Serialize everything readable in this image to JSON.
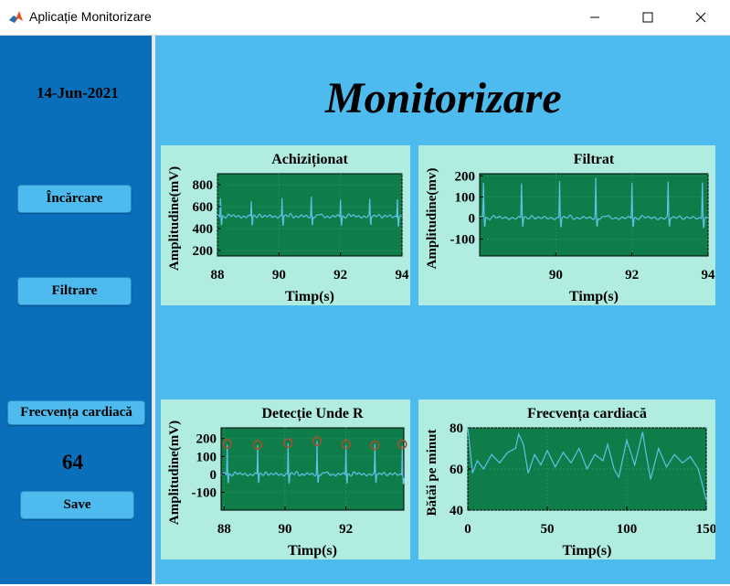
{
  "window": {
    "title": "Aplicație Monitorizare",
    "controls": [
      "minimize-icon",
      "maximize-icon",
      "close-icon"
    ]
  },
  "sidebar": {
    "date": "14-Jun-2021",
    "load_button": "Încărcare",
    "filter_button": "Filtrare",
    "heart_rate_button": "Frecvența cardiacă",
    "heart_rate_value": "64",
    "save_button": "Save"
  },
  "main": {
    "title": "Monitorizare"
  },
  "colors": {
    "sidebar": "#0a6fbb",
    "main": "#4dbbee",
    "panel": "#b0ece0",
    "plot_bg": "#0f7d4a",
    "signal": "#5fc3e8",
    "marker": "#a0522d"
  },
  "chart_data": [
    {
      "type": "line",
      "title": "Achiziționat",
      "xlabel": "Timp(s)",
      "ylabel": "Amplitudine(mV)",
      "xlim": [
        88,
        94
      ],
      "ylim": [
        150,
        900
      ],
      "xticks": [
        "88",
        "90",
        "92",
        "94"
      ],
      "yticks": [
        "200",
        "400",
        "600",
        "800"
      ],
      "baseline": 510,
      "peaks": [
        88.1,
        89.1,
        90.1,
        91.05,
        92.0,
        92.95,
        93.85
      ],
      "peak_values": [
        680,
        650,
        680,
        690,
        670,
        660,
        680
      ],
      "grid": true
    },
    {
      "type": "line",
      "title": "Filtrat",
      "xlabel": "Timp(s)",
      "ylabel": "Amplitudine(mv)",
      "xlim": [
        88,
        94
      ],
      "ylim": [
        -180,
        210
      ],
      "xticks": [
        "90",
        "92",
        "94"
      ],
      "yticks": [
        "-100",
        "0",
        "100",
        "200"
      ],
      "baseline": 0,
      "peaks": [
        88.1,
        89.1,
        90.1,
        91.05,
        92.0,
        92.95,
        93.85
      ],
      "peak_values": [
        170,
        165,
        175,
        190,
        170,
        165,
        175
      ],
      "grid": true
    },
    {
      "type": "line",
      "title": "Detecție Unde R",
      "xlabel": "Timp(s)",
      "ylabel": "Amplitudine(mV)",
      "xlim": [
        87.9,
        93.9
      ],
      "ylim": [
        -200,
        260
      ],
      "xticks": [
        "88",
        "90",
        "92"
      ],
      "yticks": [
        "-100",
        "0",
        "100",
        "200"
      ],
      "baseline": 0,
      "peaks": [
        88.1,
        89.1,
        90.1,
        91.05,
        92.0,
        92.95,
        93.85
      ],
      "peak_values": [
        170,
        165,
        175,
        185,
        168,
        162,
        168
      ],
      "markers": "R-peaks",
      "grid": true
    },
    {
      "type": "line",
      "title": "Frecvența cardiacă",
      "xlabel": "Timp(s)",
      "ylabel": "Bătăi pe minut",
      "xlim": [
        0,
        150
      ],
      "ylim": [
        40,
        80
      ],
      "xticks": [
        "0",
        "50",
        "100",
        "150"
      ],
      "yticks": [
        "40",
        "60",
        "80"
      ],
      "x": [
        0,
        3,
        6,
        10,
        15,
        20,
        25,
        30,
        32,
        35,
        38,
        42,
        46,
        50,
        55,
        60,
        65,
        70,
        75,
        80,
        85,
        88,
        92,
        95,
        100,
        105,
        110,
        112,
        115,
        120,
        125,
        130,
        135,
        140,
        145,
        150
      ],
      "y": [
        80,
        58,
        64,
        60,
        67,
        63,
        68,
        70,
        77,
        72,
        58,
        67,
        62,
        69,
        61,
        68,
        63,
        70,
        60,
        67,
        64,
        72,
        60,
        56,
        74,
        62,
        78,
        68,
        55,
        70,
        61,
        67,
        63,
        66,
        60,
        45
      ],
      "grid": true
    }
  ]
}
